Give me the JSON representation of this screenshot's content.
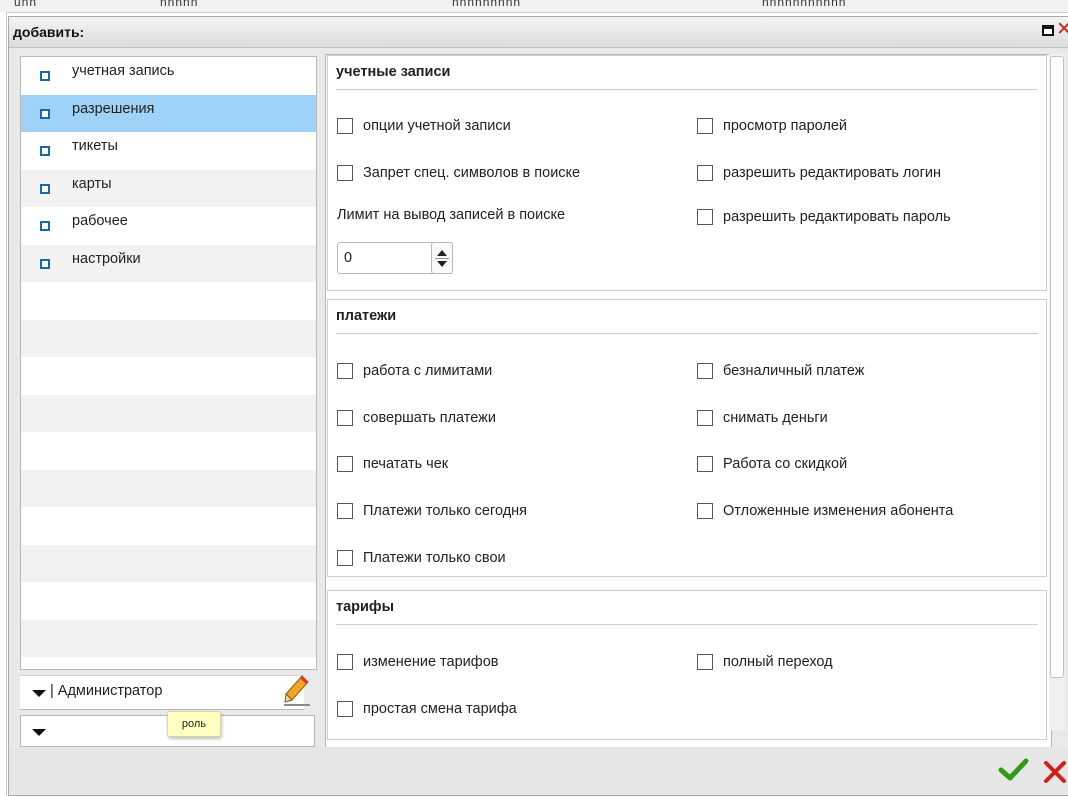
{
  "dialog": {
    "title": "добавить:",
    "colors": {
      "selection": "#9fd2f7",
      "bullet": "#1769a8",
      "ok": "#2e9a16",
      "cancel": "#d0211b"
    }
  },
  "background": {
    "header_texts": [
      "unn",
      "nnnnn",
      "nnnnnnnnn",
      "nnnnnnnnnnn"
    ]
  },
  "sidebar": {
    "items": [
      {
        "label": "учетная запись",
        "icon": "square-bullet-icon"
      },
      {
        "label": "разрешения",
        "icon": "square-bullet-icon",
        "selected": true
      },
      {
        "label": "тикеты",
        "icon": "square-bullet-icon"
      },
      {
        "label": "карты",
        "icon": "square-bullet-icon"
      },
      {
        "label": "рабочее",
        "icon": "square-bullet-icon"
      },
      {
        "label": "настройки",
        "icon": "square-bullet-icon"
      }
    ]
  },
  "role": {
    "value": "| Администратор",
    "tooltip": "роль",
    "edit_icon": "pencil-icon"
  },
  "sections": {
    "accounts": {
      "title": "учетные записи",
      "left": [
        "опции учетной записи",
        "Запрет спец. символов в поиске"
      ],
      "limit_label": "Лимит на вывод записей в поиске",
      "limit_value": "0",
      "right": [
        "просмотр паролей",
        "разрешить редактировать логин",
        "разрешить редактировать пароль"
      ]
    },
    "payments": {
      "title": "платежи",
      "left": [
        "работа с лимитами",
        "совершать платежи",
        "печатать чек",
        "Платежи только сегодня",
        "Платежи только свои"
      ],
      "right": [
        "безналичный платеж",
        "снимать деньги",
        "Работа со скидкой",
        "Отложенные изменения абонента"
      ]
    },
    "tariffs": {
      "title": "тарифы",
      "left": [
        "изменение тарифов",
        "простая смена тарифа"
      ],
      "right": [
        "полный переход"
      ]
    }
  },
  "footer": {
    "ok_icon": "checkmark-icon",
    "cancel_icon": "close-icon"
  }
}
